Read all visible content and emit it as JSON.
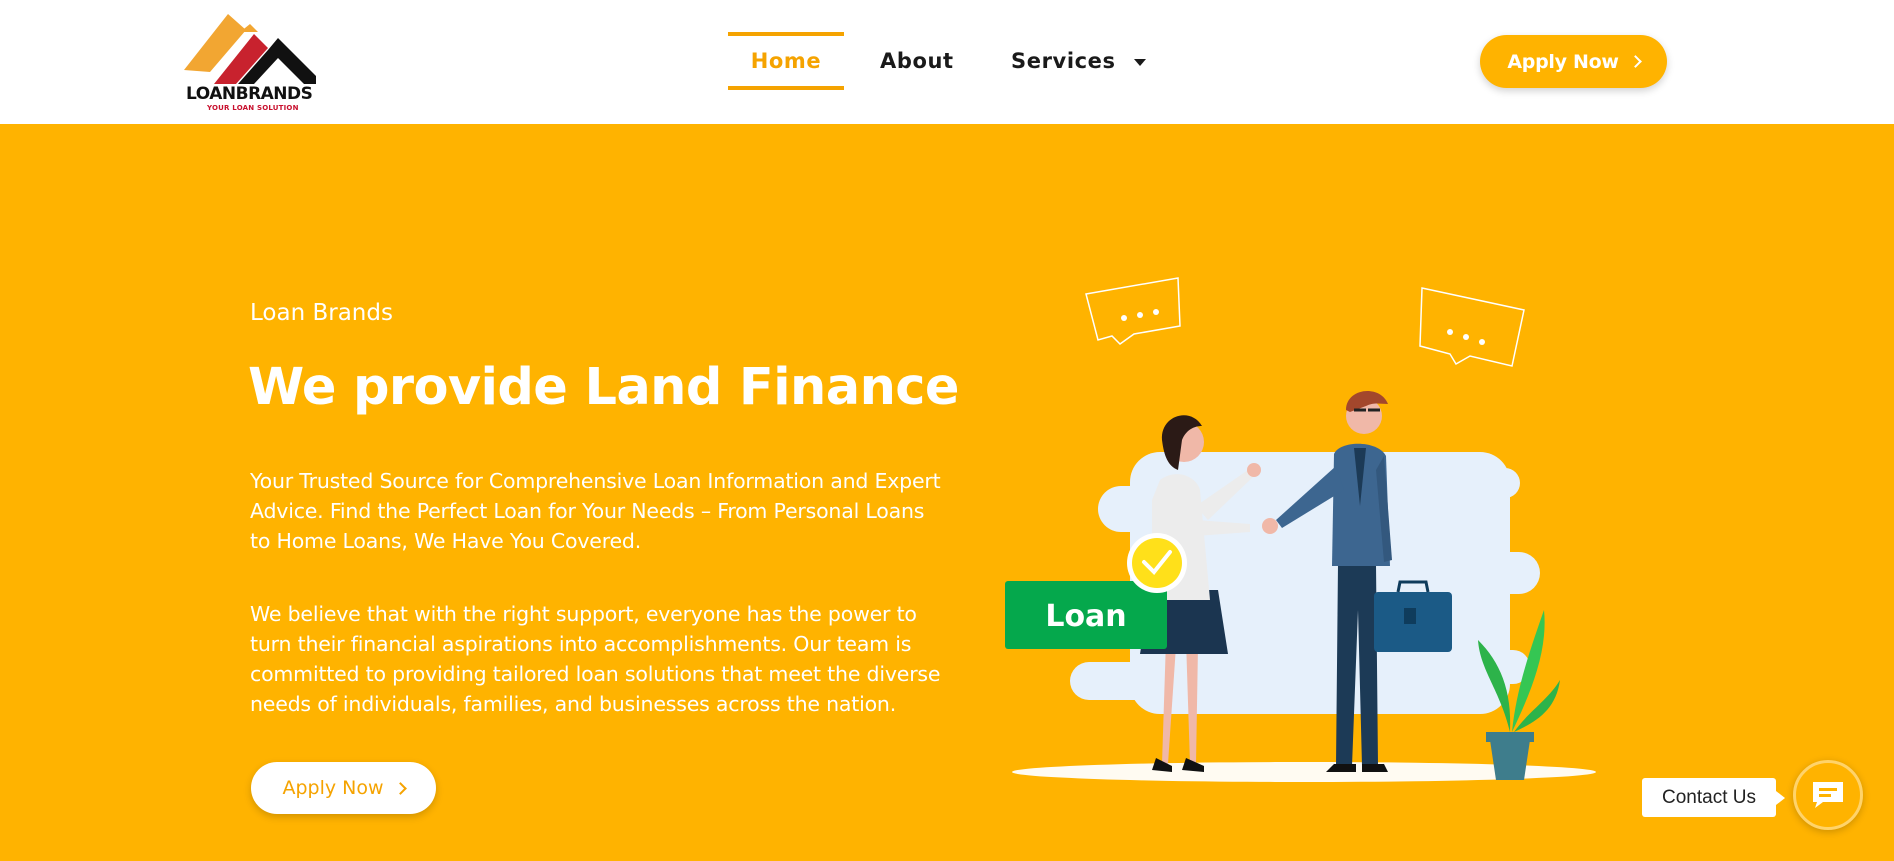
{
  "header": {
    "logo": {
      "name": "LOANBRANDS",
      "tagline": "YOUR LOAN SOLUTION"
    },
    "nav": [
      {
        "label": "Home",
        "active": true
      },
      {
        "label": "About",
        "active": false
      },
      {
        "label": "Services",
        "active": false,
        "dropdown": true
      }
    ],
    "cta_label": "Apply Now"
  },
  "hero": {
    "eyebrow": "Loan Brands",
    "title": "We provide Land Finance",
    "paragraph_1": "Your Trusted Source for Comprehensive Loan Information and Expert Advice. Find the Perfect Loan for Your Needs – From Personal Loans to Home Loans, We Have You Covered.",
    "paragraph_2": "We believe that with the right support, everyone has the power to turn their financial aspirations into accomplishments. Our team is committed to providing tailored loan solutions that meet the diverse needs of individuals, families, and businesses across the nation.",
    "cta_label": "Apply Now",
    "illustration": {
      "sign_text": "Loan"
    }
  },
  "contact": {
    "label": "Contact Us",
    "icon": "chat-icon"
  },
  "colors": {
    "accent": "#ffb300",
    "nav_active": "#f5a300",
    "text_dark": "#1a1a1a",
    "logo_red": "#c8102e",
    "loan_green": "#05a84c"
  }
}
